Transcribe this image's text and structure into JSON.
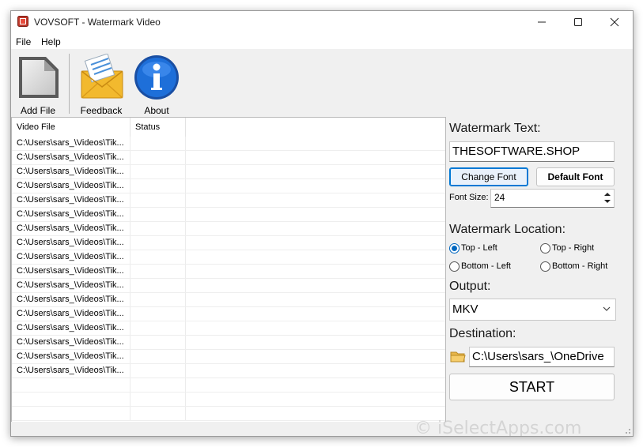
{
  "window": {
    "title": "VOVSOFT - Watermark Video"
  },
  "menu": {
    "items": [
      "File",
      "Help"
    ]
  },
  "toolbar": {
    "add_file": "Add File",
    "feedback": "Feedback",
    "about": "About"
  },
  "file_list": {
    "columns": [
      "Video File",
      "Status"
    ],
    "rows": [
      "C:\\Users\\sars_\\Videos\\Tik...",
      "C:\\Users\\sars_\\Videos\\Tik...",
      "C:\\Users\\sars_\\Videos\\Tik...",
      "C:\\Users\\sars_\\Videos\\Tik...",
      "C:\\Users\\sars_\\Videos\\Tik...",
      "C:\\Users\\sars_\\Videos\\Tik...",
      "C:\\Users\\sars_\\Videos\\Tik...",
      "C:\\Users\\sars_\\Videos\\Tik...",
      "C:\\Users\\sars_\\Videos\\Tik...",
      "C:\\Users\\sars_\\Videos\\Tik...",
      "C:\\Users\\sars_\\Videos\\Tik...",
      "C:\\Users\\sars_\\Videos\\Tik...",
      "C:\\Users\\sars_\\Videos\\Tik...",
      "C:\\Users\\sars_\\Videos\\Tik...",
      "C:\\Users\\sars_\\Videos\\Tik...",
      "C:\\Users\\sars_\\Videos\\Tik...",
      "C:\\Users\\sars_\\Videos\\Tik..."
    ],
    "empty_rows": 4
  },
  "panel": {
    "watermark_text_label": "Watermark Text:",
    "watermark_text_value": "THESOFTWARE.SHOP",
    "change_font": "Change Font",
    "default_font": "Default Font",
    "font_size_label": "Font Size:",
    "font_size_value": "24",
    "location_label": "Watermark Location:",
    "locations": [
      "Top - Left",
      "Top - Right",
      "Bottom - Left",
      "Bottom - Right"
    ],
    "selected_location": "Top - Left",
    "output_label": "Output:",
    "output_value": "MKV",
    "destination_label": "Destination:",
    "destination_value": "C:\\Users\\sars_\\OneDrive",
    "start": "START"
  },
  "watermark_overlay": "© iSelectApps.com",
  "colors": {
    "accent": "#0078d4",
    "window_bg": "#f0f0f0"
  },
  "icons": [
    "app-icon",
    "minimize-icon",
    "maximize-icon",
    "close-icon",
    "add-file-icon",
    "feedback-envelope-icon",
    "about-info-icon",
    "folder-icon",
    "chevron-down-icon",
    "spin-up-icon",
    "spin-down-icon",
    "size-grip-icon"
  ]
}
